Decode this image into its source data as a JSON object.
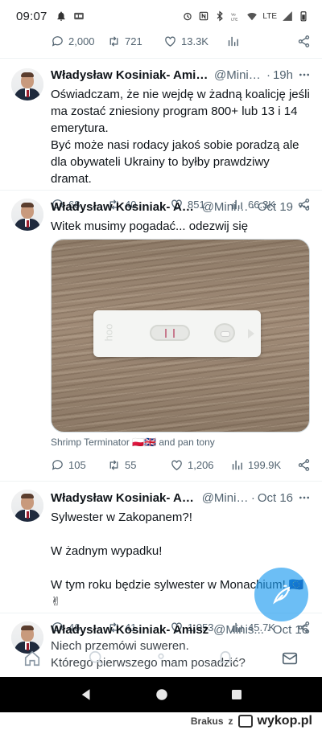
{
  "status_bar": {
    "time": "09:07",
    "network": "LTE"
  },
  "top_actions": {
    "replies": "2,000",
    "retweets": "721",
    "likes": "13.3K"
  },
  "tweets": [
    {
      "name": "Władysław Kosiniak- Amisz ...",
      "handle": "@Minist...",
      "time": "19h",
      "text": "Oświadczam, że nie wejdę w żadną koalicję jeśli ma zostać zniesiony program 800+ lub 13 i 14 emerytura.\nByć może nasi rodacy jakoś sobie poradzą ale dla obywateli Ukrainy to byłby prawdziwy dramat.",
      "replies": "68",
      "retweets": "40",
      "likes": "851",
      "views": "66.3K"
    },
    {
      "name": "Władysław Kosiniak- Amisz",
      "handle": "@Minis...",
      "time": "Oct 19",
      "text": "Witek musimy pogadać... odezwij się",
      "tagged": "Shrimp Terminator 🇵🇱🇬🇧 and pan tony",
      "replies": "105",
      "retweets": "55",
      "likes": "1,206",
      "views": "199.9K"
    },
    {
      "name": "Władysław Kosiniak- Amisz",
      "handle": "@Minis...",
      "time": "Oct 16",
      "text": "Sylwester w Zakopanem?!\n\nW żadnym wypadku!\n\nW tym roku będzie sylwester w Monachium! 🇪🇺 ✌",
      "replies": "46",
      "retweets": "41",
      "likes": "1,053",
      "views": "45.7K"
    },
    {
      "name": "Władysław Kosiniak- Amisz",
      "handle": "@Minis...",
      "time": "Oct 16",
      "text": "Niech przemówi suweren.\nKtórego pierwszego mam posadzić?"
    }
  ],
  "photo": {
    "test_brand": "hoo"
  },
  "watermark": {
    "user": "Brakus",
    "z": "z",
    "site": "wykop.pl"
  }
}
